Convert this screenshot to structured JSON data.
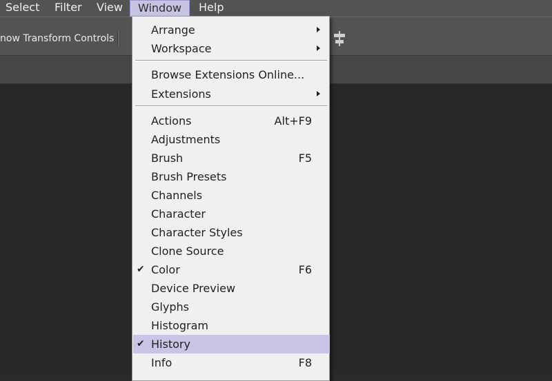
{
  "menubar": {
    "items": [
      {
        "label": "Select"
      },
      {
        "label": "Filter"
      },
      {
        "label": "View"
      },
      {
        "label": "Window"
      },
      {
        "label": "Help"
      }
    ]
  },
  "options_bar": {
    "transform_controls_label": "now Transform Controls",
    "align_icon": "distribute-icon"
  },
  "window_menu": {
    "groups": [
      [
        {
          "label": "Arrange",
          "shortcut": "",
          "submenu": true
        },
        {
          "label": "Workspace",
          "shortcut": "",
          "submenu": true
        }
      ],
      [
        {
          "label": "Browse Extensions Online...",
          "shortcut": ""
        },
        {
          "label": "Extensions",
          "shortcut": "",
          "submenu": true
        }
      ],
      [
        {
          "label": "Actions",
          "shortcut": "Alt+F9"
        },
        {
          "label": "Adjustments",
          "shortcut": ""
        },
        {
          "label": "Brush",
          "shortcut": "F5"
        },
        {
          "label": "Brush Presets",
          "shortcut": ""
        },
        {
          "label": "Channels",
          "shortcut": ""
        },
        {
          "label": "Character",
          "shortcut": ""
        },
        {
          "label": "Character Styles",
          "shortcut": ""
        },
        {
          "label": "Clone Source",
          "shortcut": ""
        },
        {
          "label": "Color",
          "shortcut": "F6",
          "checked": true
        },
        {
          "label": "Device Preview",
          "shortcut": ""
        },
        {
          "label": "Glyphs",
          "shortcut": ""
        },
        {
          "label": "Histogram",
          "shortcut": ""
        },
        {
          "label": "History",
          "shortcut": "",
          "checked": true,
          "highlighted": true
        },
        {
          "label": "Info",
          "shortcut": "F8"
        }
      ]
    ],
    "check_glyph": "✔"
  },
  "colors": {
    "menubar_bg": "#535353",
    "menu_bg": "#f0f0f0",
    "highlight": "#c8c4e6",
    "canvas_bg": "#282828"
  }
}
